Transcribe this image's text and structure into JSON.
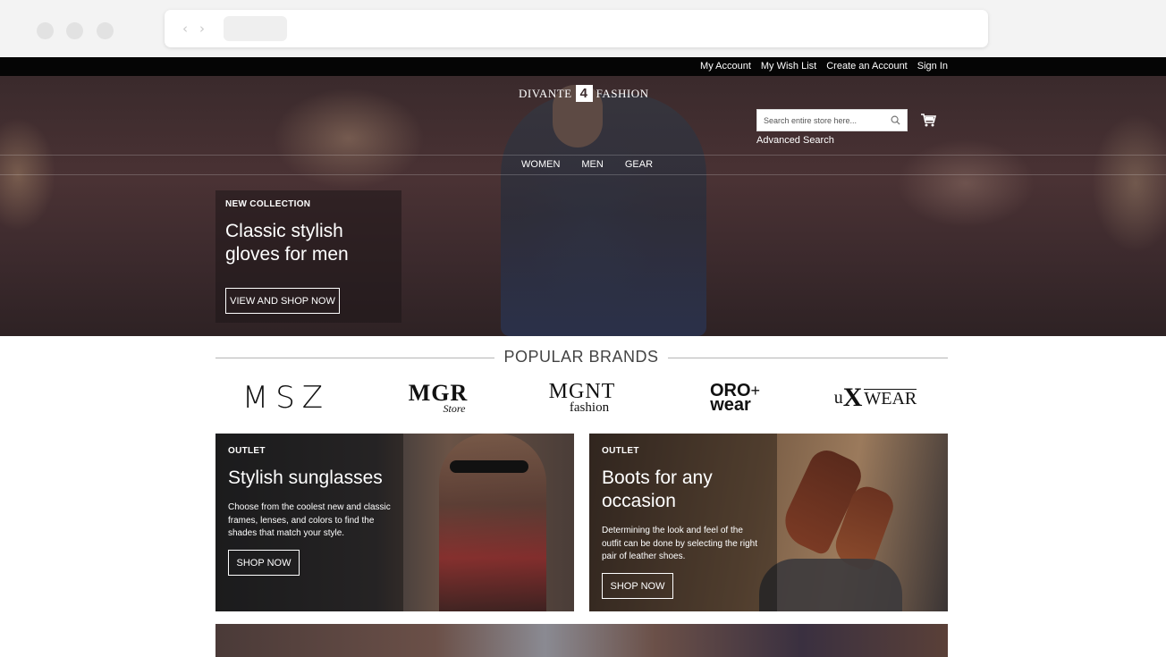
{
  "top_links": {
    "my_account": "My Account",
    "my_wish_list": "My Wish List",
    "create_account": "Create an Account",
    "sign_in": "Sign In"
  },
  "header": {
    "logo_left": "DIVANTE",
    "logo_mark": "4",
    "logo_right": "FASHION",
    "search_placeholder": "Search entire store here...",
    "advanced_search": "Advanced Search",
    "icons": [
      "search-icon",
      "cart-icon"
    ]
  },
  "main_nav": {
    "women": "WOMEN",
    "men": "MEN",
    "gear": "GEAR"
  },
  "hero": {
    "kicker": "NEW COLLECTION",
    "title": "Classic stylish gloves for men",
    "button": "VIEW AND SHOP NOW"
  },
  "brands": {
    "title": "POPULAR BRANDS",
    "items": {
      "msz": "MSZ",
      "mgr_main": "MGR",
      "mgr_sub": "Store",
      "mgnt_main": "MGNT",
      "mgnt_sub": "fashion",
      "oro_top": "ORO",
      "oro_plus": "+",
      "oro_bottom": "wear",
      "ux_u": "u",
      "ux_x": "X",
      "ux_wear": "WEAR"
    }
  },
  "outlets": {
    "sunglasses": {
      "kicker": "OUTLET",
      "title": "Stylish sunglasses",
      "text": "Choose from the coolest new and classic frames, lenses, and colors to find the shades that match your style.",
      "button": "SHOP NOW"
    },
    "boots": {
      "kicker": "OUTLET",
      "title": "Boots for any occasion",
      "text": "Determining the look and feel of the outfit can be done by selecting the right pair of leather shoes.",
      "button": "SHOP NOW"
    }
  },
  "colors": {
    "topbar": "#050505",
    "hero_tint": "#3a2a2c",
    "text_light": "#ffffff"
  }
}
